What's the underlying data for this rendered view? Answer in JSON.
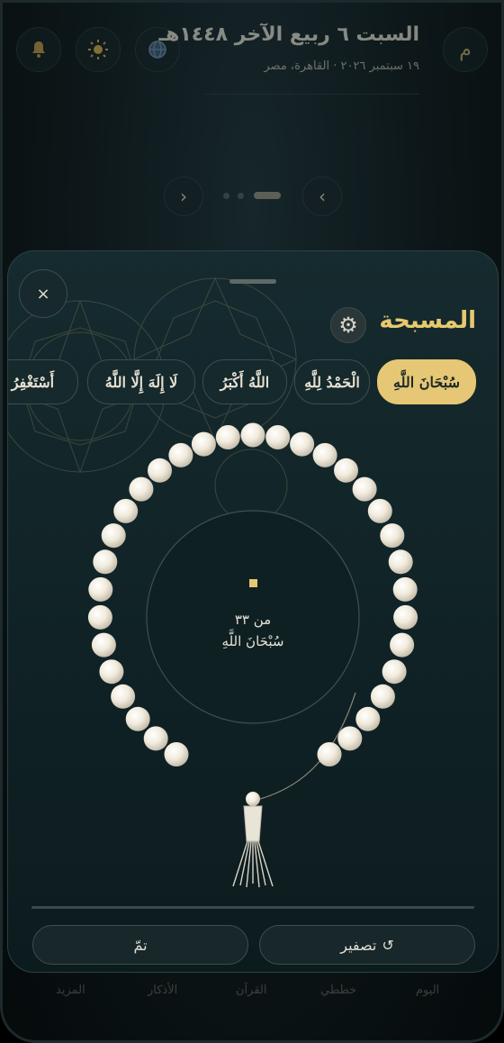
{
  "header": {
    "title": "السبت ٦ ربيع الآخر ١٤٤٨هـ",
    "subtitle": "١٩ سبتمبر ٢٠٢٦ · القاهرة، مصر",
    "profile_initial": "م",
    "icons": [
      "globe-icon",
      "sun-icon",
      "bell-icon"
    ]
  },
  "pager": {
    "prev": "‹",
    "next": "›",
    "page_count": 3,
    "active_page": 3
  },
  "bottom_nav": [
    "اليوم",
    "خططي",
    "القرآن",
    "الأذكار",
    "المزيد"
  ],
  "sheet": {
    "close_label": "×",
    "title": "المسبحة",
    "settings_icon": "gear-icon",
    "chips": [
      {
        "label": "سُبْحَانَ اللَّهِ",
        "active": true
      },
      {
        "label": "الْحَمْدُ لِلَّهِ",
        "active": false
      },
      {
        "label": "اللَّهُ أَكْبَرُ",
        "active": false
      },
      {
        "label": "لَا إِلَهَ إِلَّا اللَّهُ",
        "active": false
      },
      {
        "label": "أَسْتَغْفِرُ اللَّهَ",
        "active": false
      }
    ],
    "counter": {
      "target_label": "من ٣٣",
      "dhikr_label": "سُبْحَانَ اللَّهِ",
      "bead_count": 33,
      "count": 0
    },
    "progress": 0,
    "reset_label": "تصفير",
    "reset_icon": "↺",
    "done_label": "تمّ"
  },
  "colors": {
    "accent": "#e6c775",
    "bead": "#f3eee3",
    "sheet_bg": "#122629"
  }
}
